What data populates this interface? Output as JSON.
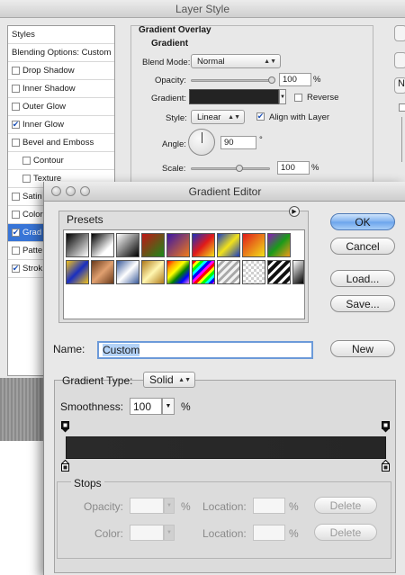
{
  "layer_style": {
    "title": "Layer Style",
    "styles_header": "Styles",
    "blending_options": "Blending Options: Custom",
    "items": [
      {
        "label": "Drop Shadow",
        "checked": false
      },
      {
        "label": "Inner Shadow",
        "checked": false
      },
      {
        "label": "Outer Glow",
        "checked": false
      },
      {
        "label": "Inner Glow",
        "checked": true
      },
      {
        "label": "Bevel and Emboss",
        "checked": false
      },
      {
        "label": "Contour",
        "checked": false
      },
      {
        "label": "Texture",
        "checked": false
      },
      {
        "label": "Satin",
        "checked": false
      },
      {
        "label": "Color",
        "checked": false
      },
      {
        "label": "Grad",
        "checked": true
      },
      {
        "label": "Patte",
        "checked": false
      },
      {
        "label": "Strok",
        "checked": true
      }
    ],
    "section_title": "Gradient Overlay",
    "subsection_title": "Gradient",
    "blend_mode_label": "Blend Mode:",
    "blend_mode_value": "Normal",
    "opacity_label": "Opacity:",
    "opacity_value": "100",
    "gradient_label": "Gradient:",
    "reverse_label": "Reverse",
    "style_label": "Style:",
    "style_value": "Linear",
    "align_label": "Align with Layer",
    "angle_label": "Angle:",
    "angle_value": "90",
    "scale_label": "Scale:",
    "scale_value": "100",
    "percent": "%",
    "degree": "°",
    "right_letter": "N"
  },
  "gradient_editor": {
    "title": "Gradient Editor",
    "presets_label": "Presets",
    "buttons": {
      "ok": "OK",
      "cancel": "Cancel",
      "load": "Load...",
      "save": "Save...",
      "new": "New"
    },
    "name_label": "Name:",
    "name_value": "Custom",
    "gradient_type_label": "Gradient Type:",
    "gradient_type_value": "Solid",
    "smoothness_label": "Smoothness:",
    "smoothness_value": "100",
    "percent": "%",
    "stops_label": "Stops",
    "opacity_label": "Opacity:",
    "color_label": "Color:",
    "location_label": "Location:",
    "delete_label": "Delete",
    "gradient_colors": [
      "#2a2a2a",
      "#262626"
    ]
  }
}
